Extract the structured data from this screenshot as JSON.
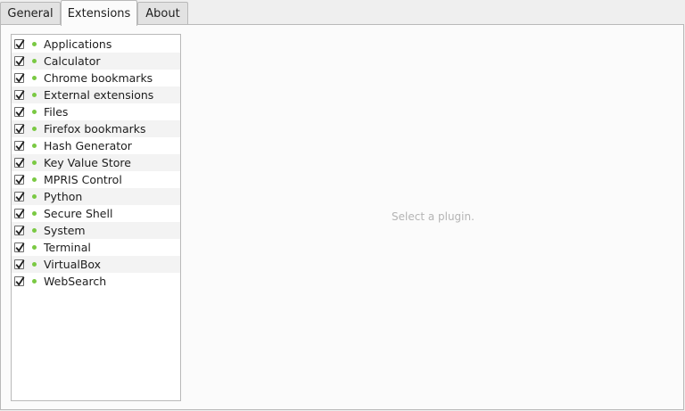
{
  "tabs": [
    {
      "label": "General"
    },
    {
      "label": "Extensions"
    },
    {
      "label": "About"
    }
  ],
  "active_tab": "Extensions",
  "plugins": [
    {
      "label": "Applications",
      "checked": true
    },
    {
      "label": "Calculator",
      "checked": true
    },
    {
      "label": "Chrome bookmarks",
      "checked": true
    },
    {
      "label": "External extensions",
      "checked": true
    },
    {
      "label": "Files",
      "checked": true
    },
    {
      "label": "Firefox bookmarks",
      "checked": true
    },
    {
      "label": "Hash Generator",
      "checked": true
    },
    {
      "label": "Key Value Store",
      "checked": true
    },
    {
      "label": "MPRIS Control",
      "checked": true
    },
    {
      "label": "Python",
      "checked": true
    },
    {
      "label": "Secure Shell",
      "checked": true
    },
    {
      "label": "System",
      "checked": true
    },
    {
      "label": "Terminal",
      "checked": true
    },
    {
      "label": "VirtualBox",
      "checked": true
    },
    {
      "label": "WebSearch",
      "checked": true
    }
  ],
  "status_dot_color": "#7ac943",
  "placeholder_text": "Select a plugin."
}
